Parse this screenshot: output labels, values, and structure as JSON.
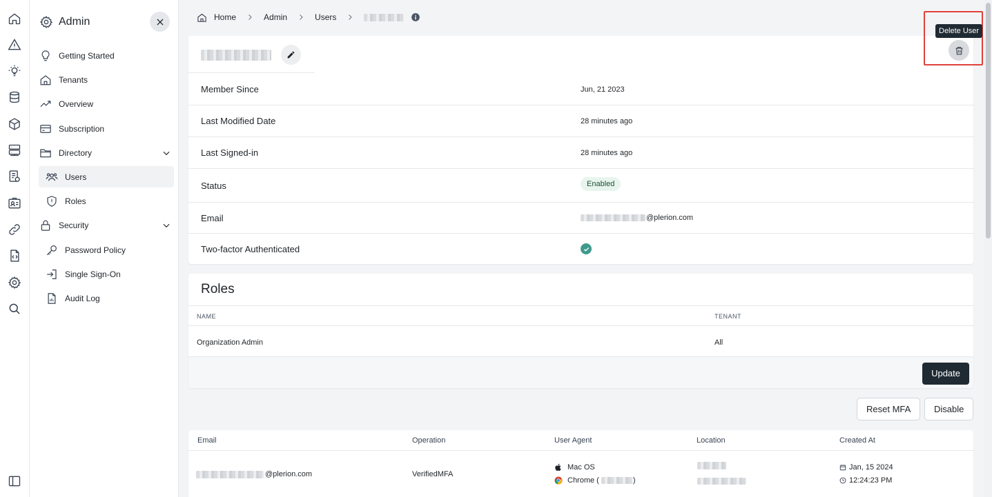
{
  "sidebar": {
    "title": "Admin",
    "items": [
      {
        "label": "Getting Started"
      },
      {
        "label": "Tenants"
      },
      {
        "label": "Overview"
      },
      {
        "label": "Subscription"
      },
      {
        "label": "Directory"
      },
      {
        "label": "Users"
      },
      {
        "label": "Roles"
      },
      {
        "label": "Security"
      },
      {
        "label": "Password Policy"
      },
      {
        "label": "Single Sign-On"
      },
      {
        "label": "Audit Log"
      }
    ]
  },
  "breadcrumb": {
    "items": [
      "Home",
      "Admin",
      "Users"
    ]
  },
  "delete_tooltip": "Delete User",
  "details": [
    {
      "label": "Member Since",
      "value": "Jun, 21 2023"
    },
    {
      "label": "Last Modified Date",
      "value": "28 minutes ago"
    },
    {
      "label": "Last Signed-in",
      "value": "28 minutes ago"
    },
    {
      "label": "Status",
      "value": "Enabled"
    },
    {
      "label": "Email",
      "value": "@plerion.com"
    },
    {
      "label": "Two-factor Authenticated",
      "value": ""
    }
  ],
  "roles": {
    "title": "Roles",
    "columns": [
      "NAME",
      "TENANT"
    ],
    "rows": [
      {
        "name": "Organization Admin",
        "tenant": "All"
      }
    ],
    "update_label": "Update"
  },
  "actions": {
    "reset_mfa": "Reset MFA",
    "disable": "Disable"
  },
  "audit": {
    "columns": [
      "Email",
      "Operation",
      "User Agent",
      "Location",
      "Created At"
    ],
    "rows": [
      {
        "email": "@plerion.com",
        "operation": "VerifiedMFA",
        "os": "Mac OS",
        "browser": "Chrome (",
        "browser_suffix": ")",
        "date": "Jan, 15 2024",
        "time": "12:24:23 PM"
      }
    ]
  },
  "colors": {
    "highlight": "#e0403a",
    "dark_button": "#1f2a33",
    "status_badge": "#e8f5ee",
    "check": "#3f9a8c"
  }
}
